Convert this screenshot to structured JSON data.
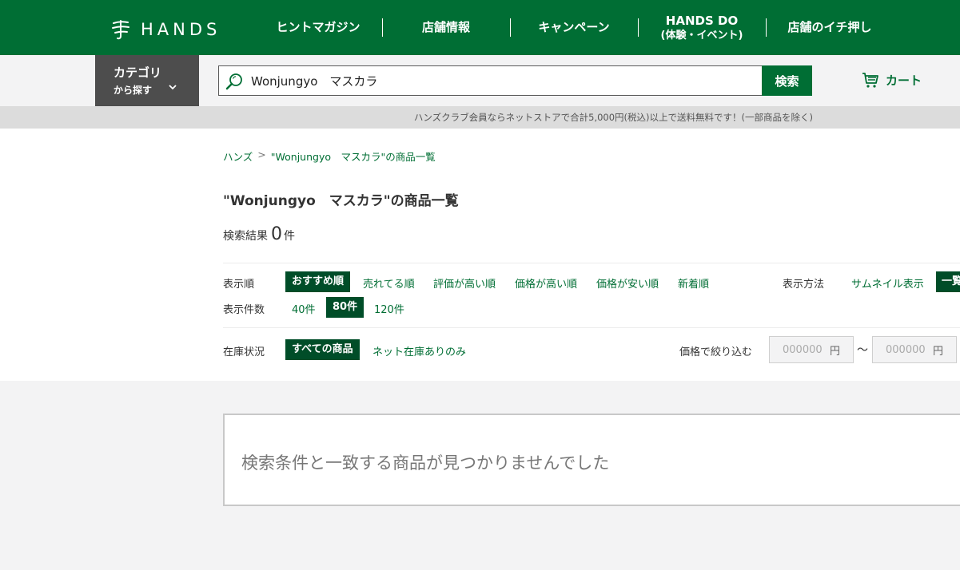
{
  "header": {
    "logo_text": "HANDS",
    "nav": [
      {
        "label": "ヒントマガジン",
        "sub": ""
      },
      {
        "label": "店舗情報",
        "sub": ""
      },
      {
        "label": "キャンペーン",
        "sub": ""
      },
      {
        "label": "HANDS DO",
        "sub": "(体験・イベント)"
      },
      {
        "label": "店舗のイチ押し",
        "sub": ""
      }
    ]
  },
  "searchbar": {
    "category_main": "カテゴリ",
    "category_sub": "から探す",
    "query": "Wonjungyo　マスカラ",
    "search_button": "検索",
    "cart_label": "カート"
  },
  "notice": "ハンズクラブ会員ならネットストアで合計5,000円(税込)以上で送料無料です！(一部商品を除く)",
  "breadcrumb": {
    "home": "ハンズ",
    "separator": ">",
    "current": "\"Wonjungyo　マスカラ\"の商品一覧"
  },
  "page_title": "\"Wonjungyo　マスカラ\"の商品一覧",
  "results": {
    "prefix": "検索結果",
    "count": "0",
    "suffix": "件"
  },
  "sort": {
    "label": "表示順",
    "options": [
      "おすすめ順",
      "売れてる順",
      "評価が高い順",
      "価格が高い順",
      "価格が安い順",
      "新着順"
    ],
    "active": "おすすめ順"
  },
  "view_mode": {
    "label": "表示方法",
    "options": [
      "サムネイル表示",
      "一覧"
    ],
    "active": "一覧"
  },
  "per_page": {
    "label": "表示件数",
    "options": [
      "40件",
      "80件",
      "120件"
    ],
    "active": "80件"
  },
  "stock": {
    "label": "在庫状況",
    "options": [
      "すべての商品",
      "ネット在庫ありのみ"
    ],
    "active": "すべての商品"
  },
  "price_filter": {
    "label": "価格で絞り込む",
    "min_placeholder": "000000",
    "max_placeholder": "000000",
    "unit": "円",
    "separator": "〜"
  },
  "empty_message": "検索条件と一致する商品が見つかりませんでした",
  "colors": {
    "brand_green": "#006e34",
    "active_dark_green": "#004d28",
    "category_gray": "#4d4d4d"
  }
}
